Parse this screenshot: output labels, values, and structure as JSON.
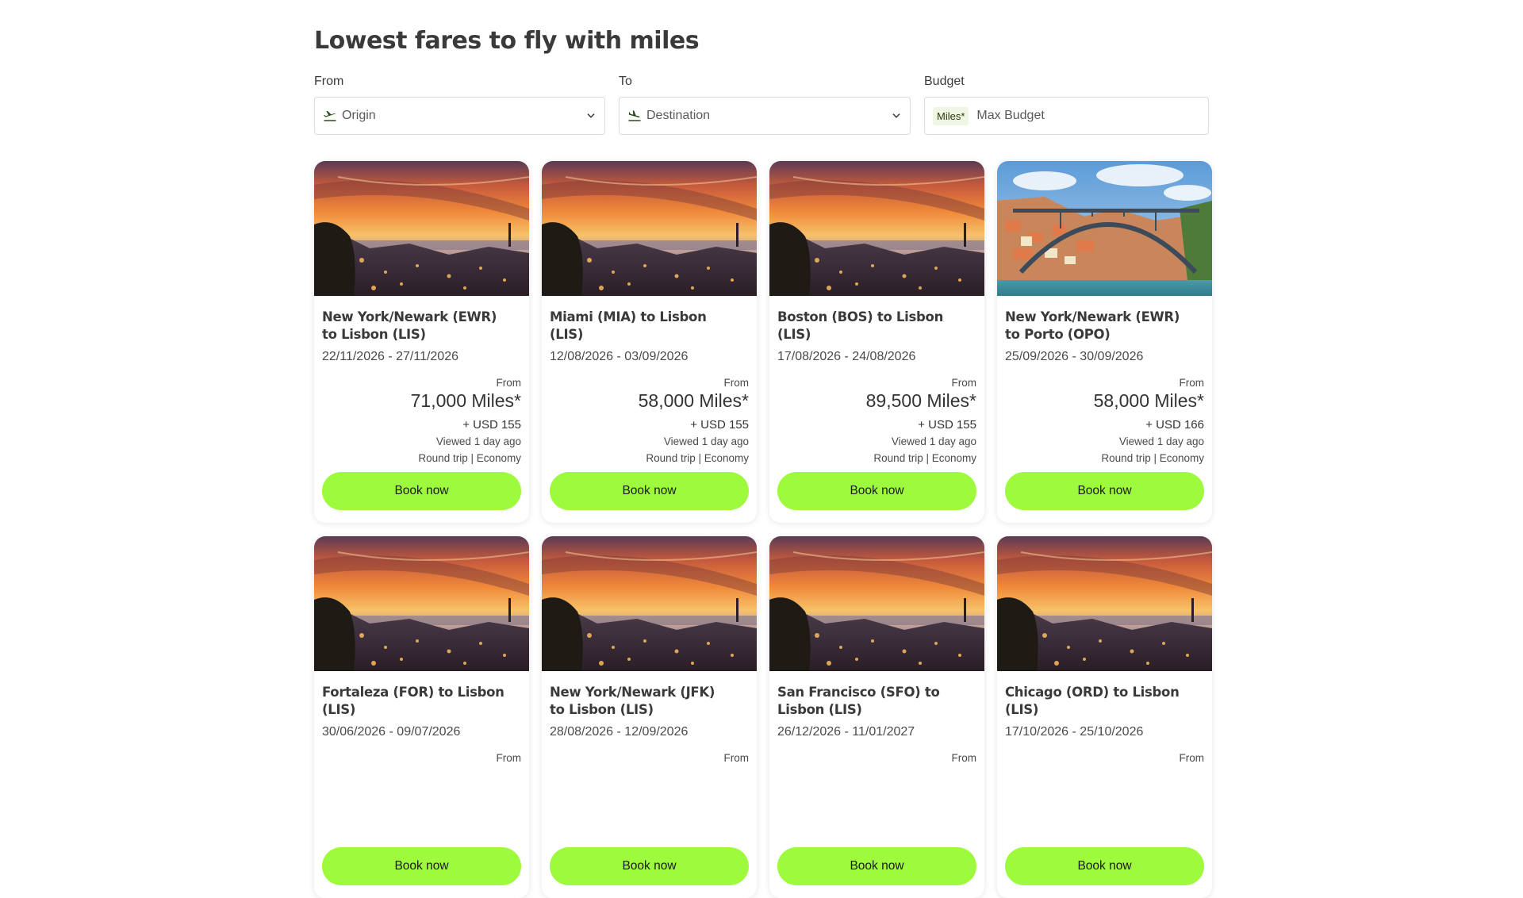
{
  "header": {
    "title": "Lowest fares to fly with miles"
  },
  "filters": {
    "from": {
      "label": "From",
      "placeholder": "Origin"
    },
    "to": {
      "label": "To",
      "placeholder": "Destination"
    },
    "budget": {
      "label": "Budget",
      "tag": "Miles*",
      "placeholder": "Max Budget"
    }
  },
  "cards": [
    {
      "route": "New York/Newark (EWR) to Lisbon (LIS)",
      "dates": "22/11/2026 - 27/11/2026",
      "from_label": "From",
      "price": "71,000 Miles*",
      "tax": "+ USD 155",
      "viewed": "Viewed 1 day ago",
      "trip": "Round trip | Economy",
      "cta": "Book now",
      "image": "lisbon-sunset"
    },
    {
      "route": "Miami (MIA) to Lisbon (LIS)",
      "dates": "12/08/2026 - 03/09/2026",
      "from_label": "From",
      "price": "58,000 Miles*",
      "tax": "+ USD 155",
      "viewed": "Viewed 1 day ago",
      "trip": "Round trip | Economy",
      "cta": "Book now",
      "image": "lisbon-sunset"
    },
    {
      "route": "Boston (BOS) to Lisbon (LIS)",
      "dates": "17/08/2026 - 24/08/2026",
      "from_label": "From",
      "price": "89,500 Miles*",
      "tax": "+ USD 155",
      "viewed": "Viewed 1 day ago",
      "trip": "Round trip | Economy",
      "cta": "Book now",
      "image": "lisbon-sunset"
    },
    {
      "route": "New York/Newark (EWR) to Porto (OPO)",
      "dates": "25/09/2026 - 30/09/2026",
      "from_label": "From",
      "price": "58,000 Miles*",
      "tax": "+ USD 166",
      "viewed": "Viewed 1 day ago",
      "trip": "Round trip | Economy",
      "cta": "Book now",
      "image": "porto-bridge"
    },
    {
      "route": "Fortaleza (FOR) to Lisbon (LIS)",
      "dates": "30/06/2026 - 09/07/2026",
      "from_label": "From",
      "price": "",
      "tax": "",
      "viewed": "",
      "trip": "",
      "cta": "Book now",
      "image": "lisbon-sunset"
    },
    {
      "route": "New York/Newark (JFK) to Lisbon (LIS)",
      "dates": "28/08/2026 - 12/09/2026",
      "from_label": "From",
      "price": "",
      "tax": "",
      "viewed": "",
      "trip": "",
      "cta": "Book now",
      "image": "lisbon-sunset"
    },
    {
      "route": "San Francisco (SFO) to Lisbon (LIS)",
      "dates": "26/12/2026 - 11/01/2027",
      "from_label": "From",
      "price": "",
      "tax": "",
      "viewed": "",
      "trip": "",
      "cta": "Book now",
      "image": "lisbon-sunset"
    },
    {
      "route": "Chicago (ORD) to Lisbon (LIS)",
      "dates": "17/10/2026 - 25/10/2026",
      "from_label": "From",
      "price": "",
      "tax": "",
      "viewed": "",
      "trip": "",
      "cta": "Book now",
      "image": "lisbon-sunset"
    }
  ],
  "icons": {
    "origin": "plane-takeoff-icon",
    "destination": "plane-landing-icon",
    "dropdown": "chevron-down-icon"
  },
  "colors": {
    "cta": "#9efa3c",
    "miles_tag_bg": "#f0f6e4"
  }
}
